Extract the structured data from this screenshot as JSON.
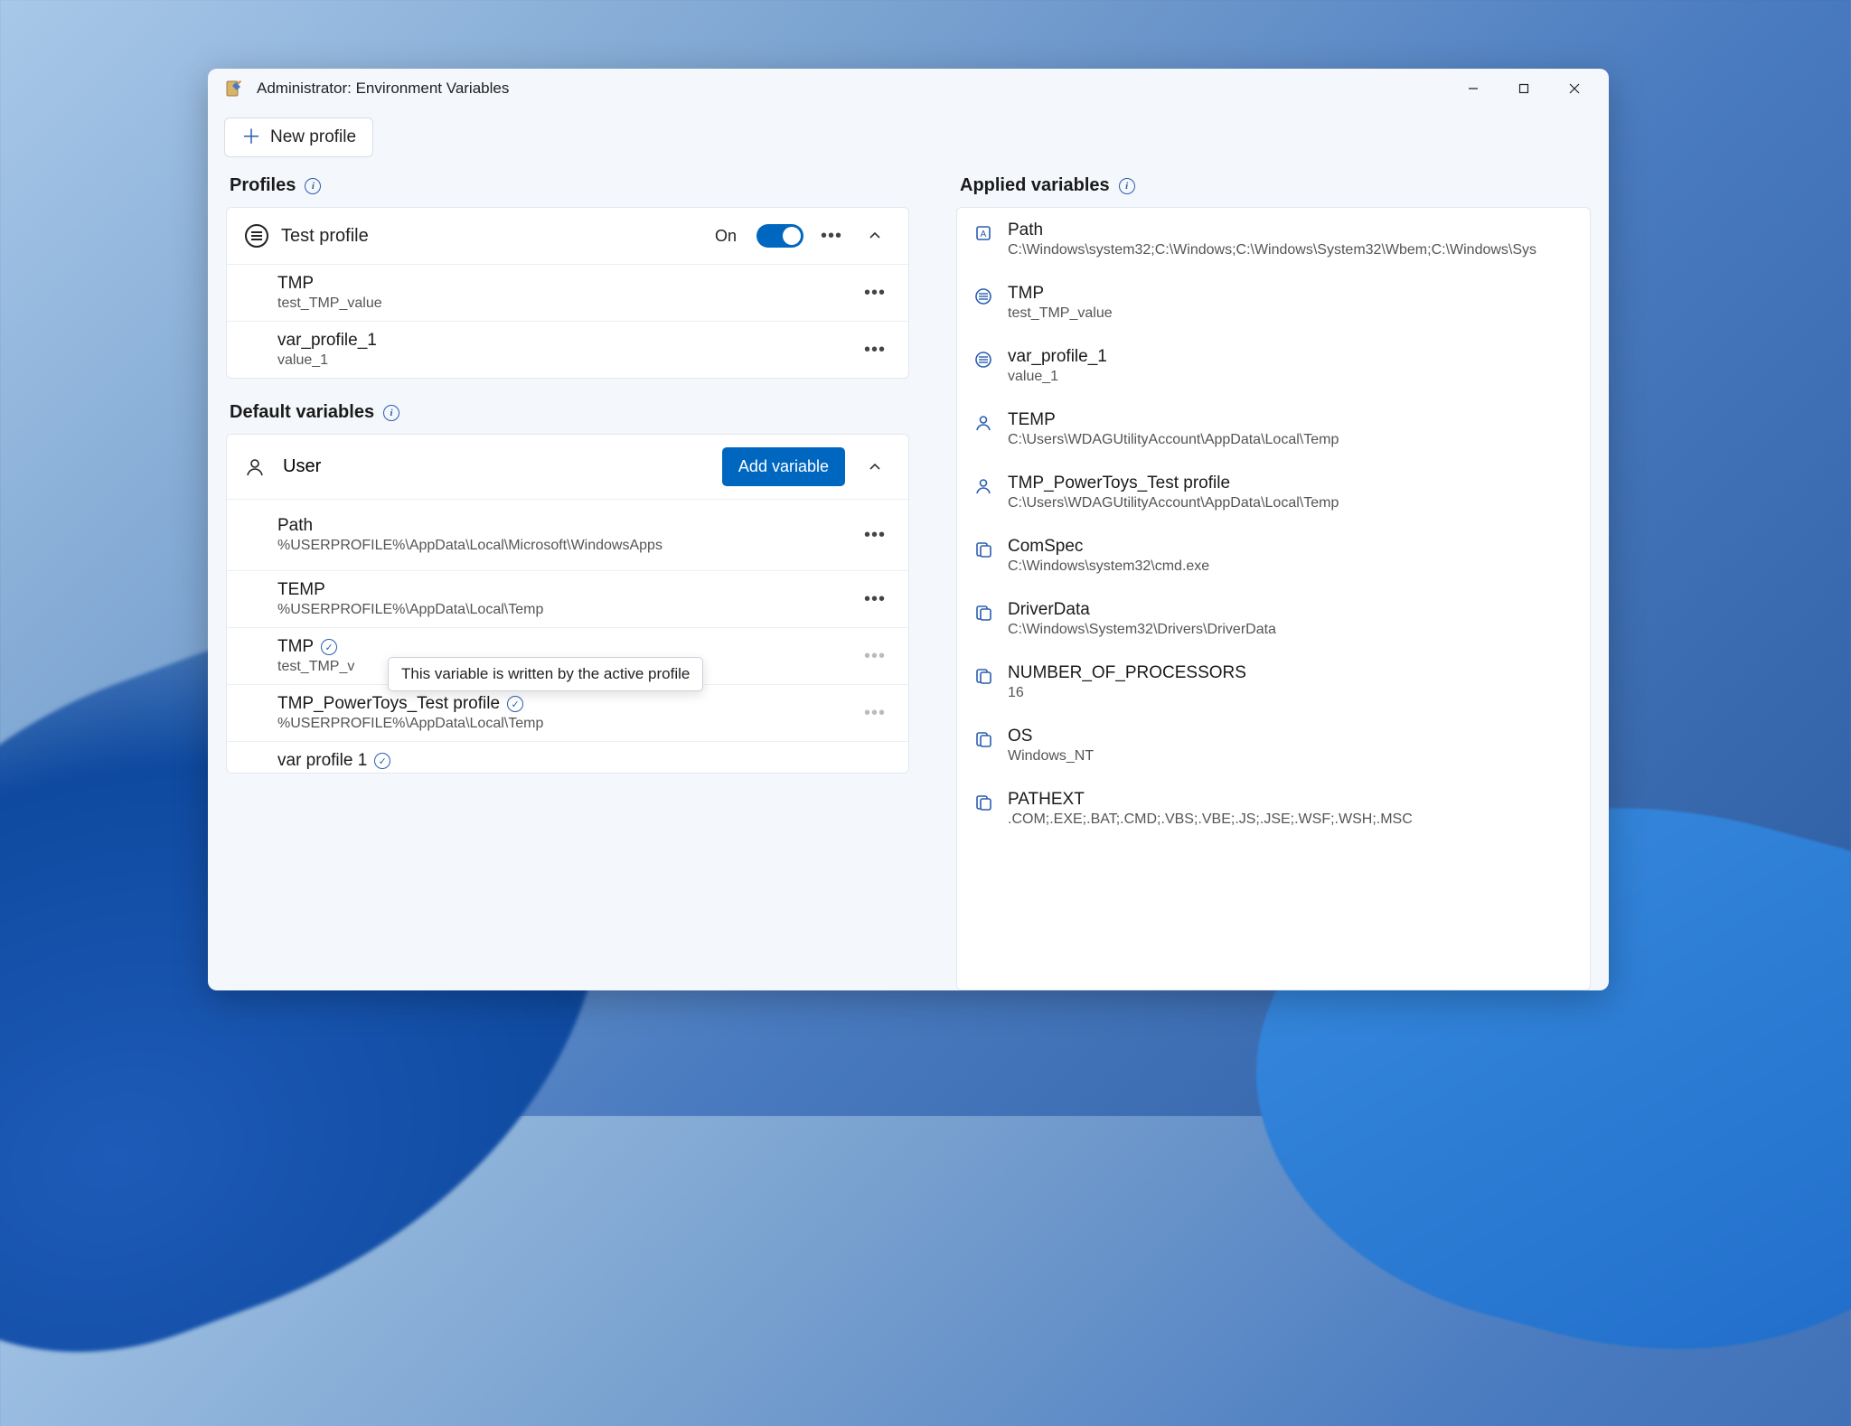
{
  "window": {
    "title": "Administrator: Environment Variables"
  },
  "toolbar": {
    "new_profile_label": "New profile"
  },
  "profiles": {
    "heading": "Profiles",
    "items": [
      {
        "name": "Test profile",
        "toggle_label": "On",
        "state": "on",
        "vars": [
          {
            "name": "TMP",
            "value": "test_TMP_value"
          },
          {
            "name": "var_profile_1",
            "value": "value_1"
          }
        ]
      }
    ]
  },
  "default_vars": {
    "heading": "Default variables",
    "groups": [
      {
        "label": "User",
        "add_button_label": "Add variable",
        "vars": [
          {
            "name": "Path",
            "value": "%USERPROFILE%\\AppData\\Local\\Microsoft\\WindowsApps",
            "overridden": false
          },
          {
            "name": "TEMP",
            "value": "%USERPROFILE%\\AppData\\Local\\Temp",
            "overridden": false
          },
          {
            "name": "TMP",
            "value": "test_TMP_v",
            "overridden": true
          },
          {
            "name": "TMP_PowerToys_Test profile",
            "value": "%USERPROFILE%\\AppData\\Local\\Temp",
            "overridden": true
          },
          {
            "name": "var profile 1",
            "value": "",
            "overridden": true
          }
        ]
      }
    ]
  },
  "applied": {
    "heading": "Applied variables",
    "items": [
      {
        "source": "system-a",
        "name": "Path",
        "value": "C:\\Windows\\system32;C:\\Windows;C:\\Windows\\System32\\Wbem;C:\\Windows\\Sys"
      },
      {
        "source": "profile",
        "name": "TMP",
        "value": "test_TMP_value"
      },
      {
        "source": "profile",
        "name": "var_profile_1",
        "value": "value_1"
      },
      {
        "source": "user",
        "name": "TEMP",
        "value": "C:\\Users\\WDAGUtilityAccount\\AppData\\Local\\Temp"
      },
      {
        "source": "user",
        "name": "TMP_PowerToys_Test profile",
        "value": "C:\\Users\\WDAGUtilityAccount\\AppData\\Local\\Temp"
      },
      {
        "source": "system",
        "name": "ComSpec",
        "value": "C:\\Windows\\system32\\cmd.exe"
      },
      {
        "source": "system",
        "name": "DriverData",
        "value": "C:\\Windows\\System32\\Drivers\\DriverData"
      },
      {
        "source": "system",
        "name": "NUMBER_OF_PROCESSORS",
        "value": "16"
      },
      {
        "source": "system",
        "name": "OS",
        "value": "Windows_NT"
      },
      {
        "source": "system",
        "name": "PATHEXT",
        "value": ".COM;.EXE;.BAT;.CMD;.VBS;.VBE;.JS;.JSE;.WSF;.WSH;.MSC"
      }
    ]
  },
  "tooltip": {
    "text": "This variable is written by the active profile"
  }
}
